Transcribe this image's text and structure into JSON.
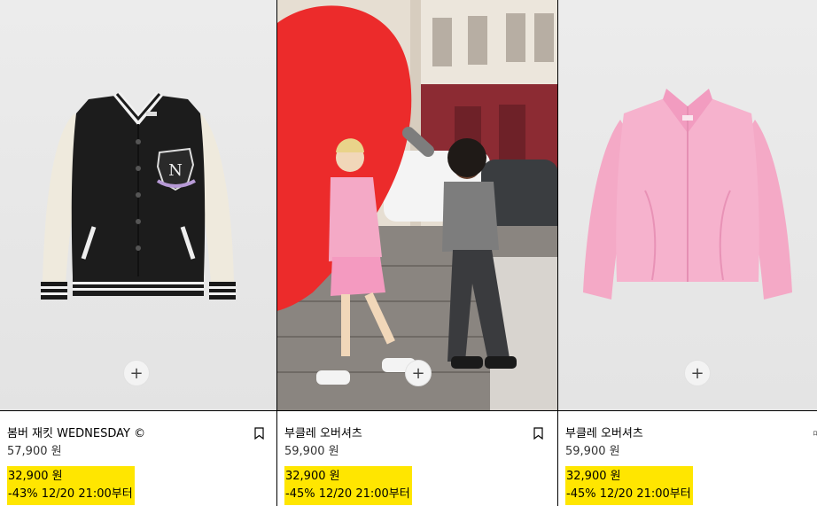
{
  "products": [
    {
      "name": "봄버 재킷 WEDNESDAY ©",
      "original_price": "57,900 원",
      "sale_price": "32,900 원",
      "sale_note": "-43% 12/20 21:00부터",
      "quick_add": "+"
    },
    {
      "name": "부클레 오버셔츠",
      "original_price": "59,900 원",
      "sale_price": "32,900 원",
      "sale_note": "-45% 12/20 21:00부터",
      "quick_add": "+"
    },
    {
      "name": "부클레 오버셔츠",
      "original_price": "59,900 원",
      "sale_price": "32,900 원",
      "sale_note": "-45% 12/20 21:00부터",
      "quick_add": "+"
    }
  ],
  "colors": {
    "sale_highlight": "#ffe600",
    "divider": "#000000",
    "product_background": "#e9e9e9",
    "jacket_pink": "#f4a9c6",
    "balloon_red": "#ec2b2b"
  },
  "icons": [
    "plus-icon",
    "bookmark-icon"
  ]
}
